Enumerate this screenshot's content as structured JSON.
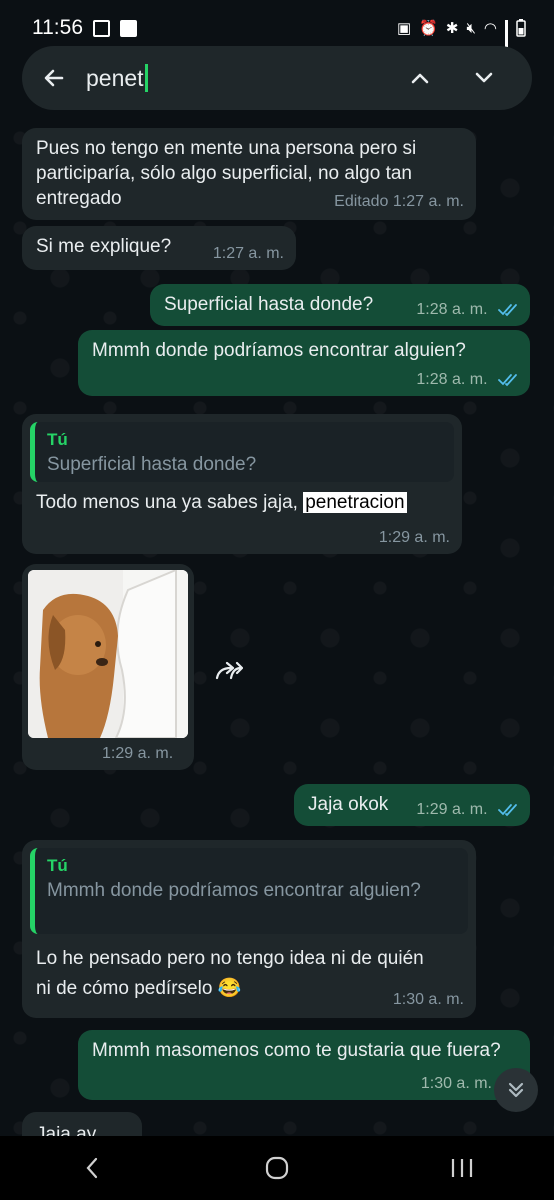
{
  "status_bar": {
    "time": "11:56"
  },
  "search": {
    "query": "penet"
  },
  "messages": [
    {
      "dir": "in",
      "text": "Pues no tengo en mente una persona pero si participaría, sólo algo superficial, no algo tan entregado",
      "time": "Editado 1:27 a. m."
    },
    {
      "dir": "in",
      "text": "Si me explique?",
      "time": "1:27 a. m."
    },
    {
      "dir": "out",
      "text": "Superficial hasta donde?",
      "time": "1:28 a. m."
    },
    {
      "dir": "out",
      "text": "Mmmh donde podríamos encontrar alguien?",
      "time": "1:28 a. m."
    },
    {
      "dir": "in",
      "quote_author": "Tú",
      "quote_text": "Superficial hasta donde?",
      "text": "Todo menos una ya sabes jaja,",
      "highlight": "penetracion",
      "time": "1:29 a. m."
    },
    {
      "dir": "in",
      "type": "image",
      "time": "1:29 a. m."
    },
    {
      "dir": "out",
      "text": "Jaja okok",
      "time": "1:29 a. m."
    },
    {
      "dir": "in",
      "quote_author": "Tú",
      "quote_text": "Mmmh donde podríamos encontrar alguien?",
      "text": "Lo he pensado pero no tengo idea ni de quién ni de cómo pedírselo",
      "emoji": "😂",
      "time": "1:30 a. m."
    },
    {
      "dir": "out",
      "text": "Mmmh masomenos como te gustaria que fuera?",
      "time": "1:30 a. m."
    },
    {
      "dir": "in",
      "text": "Jaja ay"
    }
  ]
}
